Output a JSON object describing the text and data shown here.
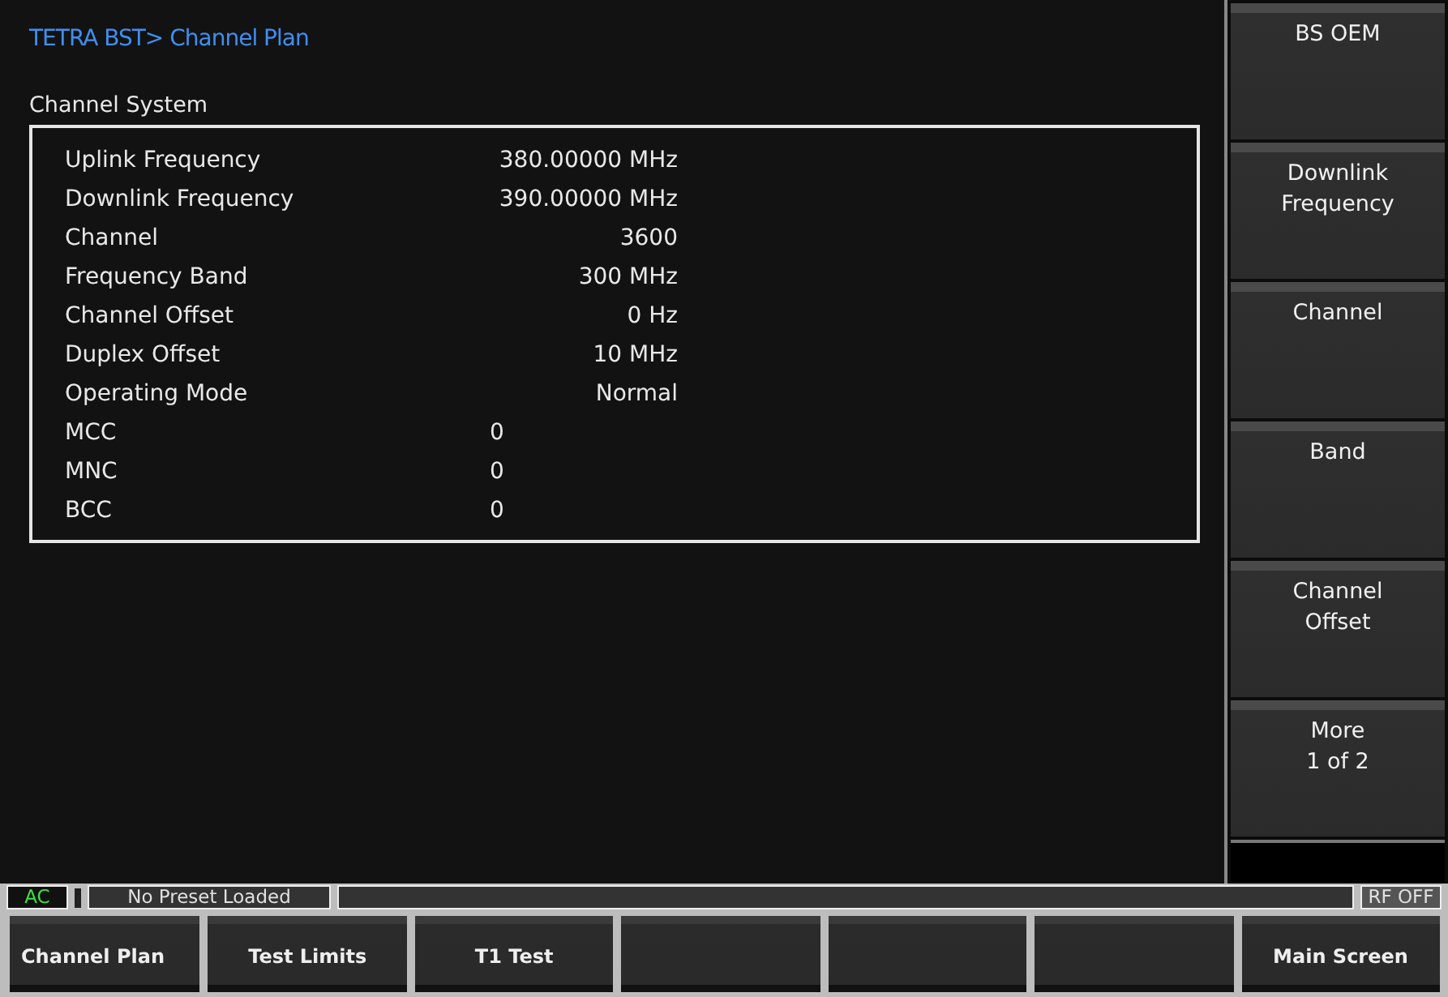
{
  "breadcrumb": "TETRA BST> Channel Plan",
  "section_title": "Channel System",
  "settings": [
    {
      "label": "Uplink Frequency",
      "value": "380.00000 MHz",
      "kind": "setting"
    },
    {
      "label": "Downlink Frequency",
      "value": "390.00000 MHz",
      "kind": "setting"
    },
    {
      "label": "Channel",
      "value": "3600",
      "kind": "setting"
    },
    {
      "label": "Frequency Band",
      "value": "300 MHz",
      "kind": "setting"
    },
    {
      "label": "Channel Offset",
      "value": "0 Hz",
      "kind": "setting"
    },
    {
      "label": "Duplex Offset",
      "value": "10 MHz",
      "kind": "setting"
    },
    {
      "label": "Operating Mode",
      "value": "Normal",
      "kind": "setting"
    },
    {
      "label": "MCC",
      "value": "0",
      "kind": "code"
    },
    {
      "label": "MNC",
      "value": "0",
      "kind": "code"
    },
    {
      "label": "BCC",
      "value": "0",
      "kind": "code"
    }
  ],
  "soft_keys": [
    [
      "BS OEM"
    ],
    [
      "Downlink",
      "Frequency"
    ],
    [
      "Channel"
    ],
    [
      "Band"
    ],
    [
      "Channel",
      "Offset"
    ],
    [
      "More",
      "1 of 2"
    ]
  ],
  "status_bar": {
    "power": "AC",
    "preset": "No Preset Loaded",
    "rf": "RF OFF"
  },
  "bottom_keys": [
    {
      "kind": "labeled",
      "label": "Channel Plan"
    },
    {
      "kind": "labeled",
      "label": "Test Limits"
    },
    {
      "kind": "labeled",
      "label": "T1 Test"
    },
    {
      "kind": "blank"
    },
    {
      "kind": "blank"
    },
    {
      "kind": "blank"
    },
    {
      "kind": "labeled",
      "label": "Main Screen"
    }
  ]
}
